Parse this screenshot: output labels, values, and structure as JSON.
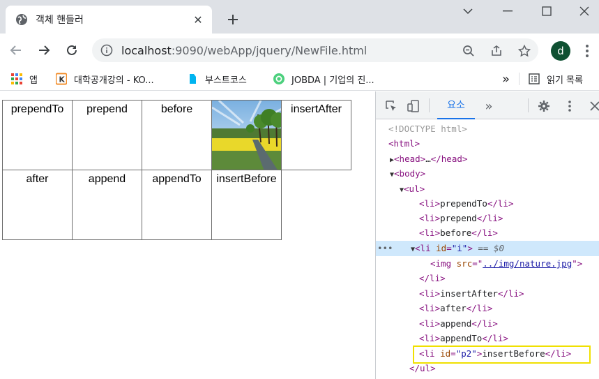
{
  "tab": {
    "title": "객체 핸들러",
    "close": "✕"
  },
  "toolbar": {
    "url_host": "localhost",
    "url_path": ":9090/webApp/jquery/NewFile.html",
    "avatar_letter": "d"
  },
  "bookmarks": [
    {
      "label": "앱"
    },
    {
      "label": "대학공개강의 - KO..."
    },
    {
      "label": "부스트코스"
    },
    {
      "label": "JOBDA | 기업의 진..."
    }
  ],
  "bookmarks_more": "»",
  "reading_list": "읽기 목록",
  "page": {
    "row1": [
      "prependTo",
      "prepend",
      "before",
      "",
      "insertAfter"
    ],
    "row2": [
      "after",
      "append",
      "appendTo",
      "insertBefore"
    ]
  },
  "devtools": {
    "tab_label": "요소",
    "more_tabs": "»",
    "lines": {
      "doctype": "<!DOCTYPE html>",
      "html_open": "<html>",
      "head_tag": "<head>",
      "head_ellipsis": "…",
      "head_close": "</head>",
      "body_open": "<body>",
      "ul_open": "<ul>",
      "li1_text": "prependTo",
      "li2_text": "prepend",
      "li3_text": "before",
      "li_i_attr": "id",
      "li_i_val": "\"i\"",
      "eq_dollar": "== $0",
      "img_attr": "src",
      "img_val": "../img/nature.jpg",
      "li_close": "</li>",
      "li5_text": "insertAfter",
      "li6_text": "after",
      "li7_text": "append",
      "li8_text": "appendTo",
      "li_p2_attr": "id",
      "li_p2_val": "\"p2\"",
      "li_p2_text": "insertBefore",
      "ul_close": "</ul>"
    }
  }
}
